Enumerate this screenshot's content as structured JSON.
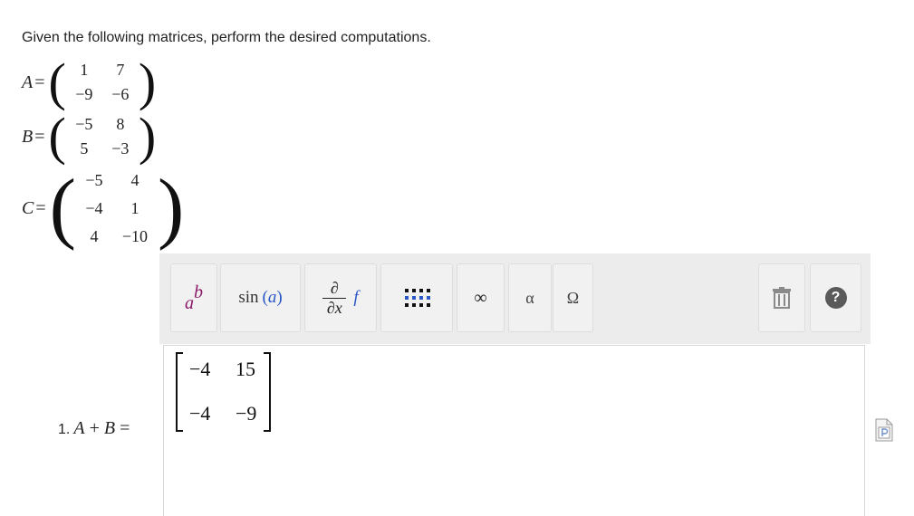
{
  "prompt": "Given the following matrices, perform the desired computations.",
  "matrices": {
    "A": {
      "label": "A",
      "eq": "=",
      "rows": [
        [
          "1",
          "7"
        ],
        [
          "−9",
          "−6"
        ]
      ]
    },
    "B": {
      "label": "B",
      "eq": "=",
      "rows": [
        [
          "−5",
          "8"
        ],
        [
          "5",
          "−3"
        ]
      ]
    },
    "C": {
      "label": "C",
      "eq": "=",
      "rows": [
        [
          "−5",
          "4"
        ],
        [
          "−4",
          "1"
        ],
        [
          "4",
          "−10"
        ]
      ]
    }
  },
  "toolbar": {
    "superscript": {
      "base": "a",
      "exp": "b"
    },
    "sin": {
      "fn": "sin",
      "open": "(",
      "arg": "a",
      "close": ")"
    },
    "derivative": {
      "num": "∂",
      "den": "∂x",
      "f": "f"
    },
    "infinity": "∞",
    "alpha": "α",
    "omega": "Ω",
    "help": "?"
  },
  "answer": {
    "rows": [
      [
        "−4",
        "15"
      ],
      [
        "−4",
        "−9"
      ]
    ]
  },
  "question": {
    "number": "1.",
    "lhs_a": "A",
    "plus": " + ",
    "lhs_b": "B",
    "eq": " ="
  }
}
